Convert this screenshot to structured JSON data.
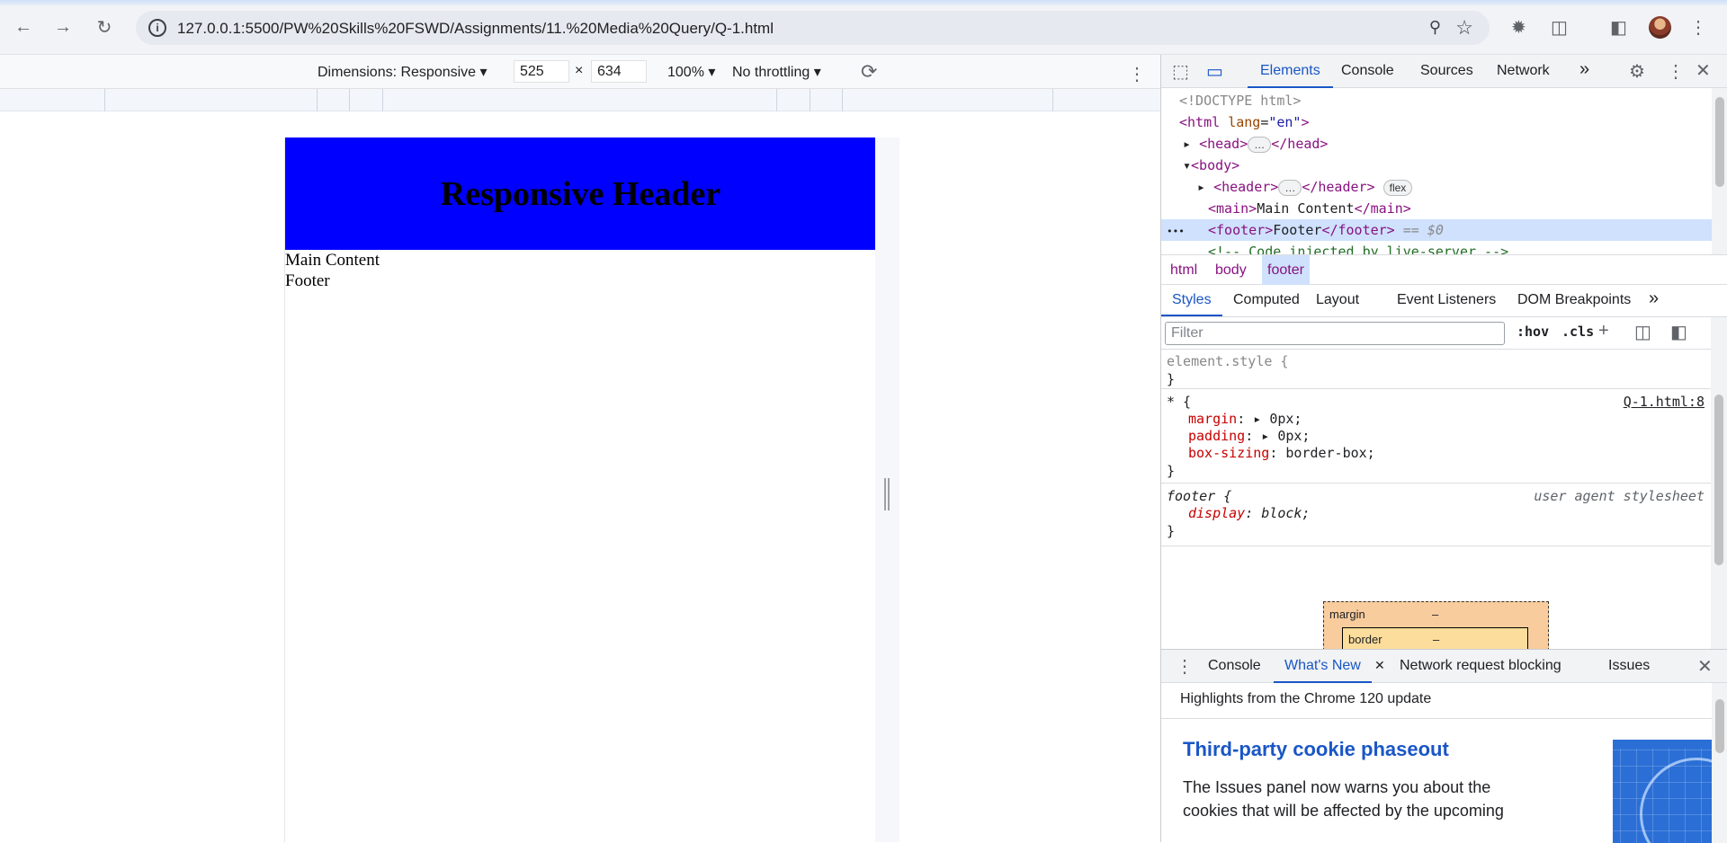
{
  "browser": {
    "url": "127.0.0.1:5500/PW%20Skills%20FSWD/Assignments/11.%20Media%20Query/Q-1.html"
  },
  "device_toolbar": {
    "dimensions_label": "Dimensions: Responsive",
    "width": "525",
    "height_value": "634",
    "times": "×",
    "zoom": "100%",
    "throttling": "No throttling"
  },
  "page": {
    "header_title": "Responsive Header",
    "main_text": "Main Content",
    "footer_text": "Footer",
    "header_color": "#0000ff"
  },
  "devtools": {
    "tabs": [
      "Elements",
      "Console",
      "Sources",
      "Network"
    ],
    "more": "»",
    "dom": {
      "doctype": "<!DOCTYPE html>",
      "html_open": "<html",
      "lang_attr": "lang",
      "lang_val": "\"en\"",
      "html_close_bracket": ">",
      "head_open": "<head>",
      "ellipsis": "…",
      "head_close": "</head>",
      "body_open": "<body>",
      "header_open": "<header>",
      "header_close": "</header>",
      "flex_badge": "flex",
      "main_open": "<main>",
      "main_text": "Main Content",
      "main_close": "</main>",
      "footer_open": "<footer>",
      "footer_text": "Footer",
      "footer_close": "</footer>",
      "selected_marker": "== $0",
      "comment": "<!-- Code injected by live-server -->",
      "row_dots": "•••"
    },
    "breadcrumbs": [
      "html",
      "body",
      "footer"
    ],
    "style_tabs": [
      "Styles",
      "Computed",
      "Layout",
      "Event Listeners",
      "DOM Breakpoints"
    ],
    "filter_placeholder": "Filter",
    "hov": ":hov",
    "cls": ".cls",
    "styles": {
      "element_style": "element.style {",
      "close_brace": "}",
      "universal_selector": "* {",
      "source": "Q-1.html:8",
      "margin_prop": "margin",
      "margin_val": "0px;",
      "padding_prop": "padding",
      "padding_val": "0px;",
      "boxsizing_prop": "box-sizing",
      "boxsizing_val": "border-box;",
      "footer_selector": "footer {",
      "ua_label": "user agent stylesheet",
      "display_prop": "display",
      "display_val": "block;"
    },
    "box_model": {
      "margin_label": "margin",
      "margin_val": "–",
      "border_label": "border",
      "border_val": "–"
    },
    "drawer": {
      "tabs": [
        "Console",
        "What's New",
        "Network request blocking",
        "Issues"
      ],
      "subtitle": "Highlights from the Chrome 120 update",
      "title": "Third-party cookie phaseout",
      "body": "The Issues panel now warns you about the cookies that will be affected by the upcoming"
    }
  }
}
